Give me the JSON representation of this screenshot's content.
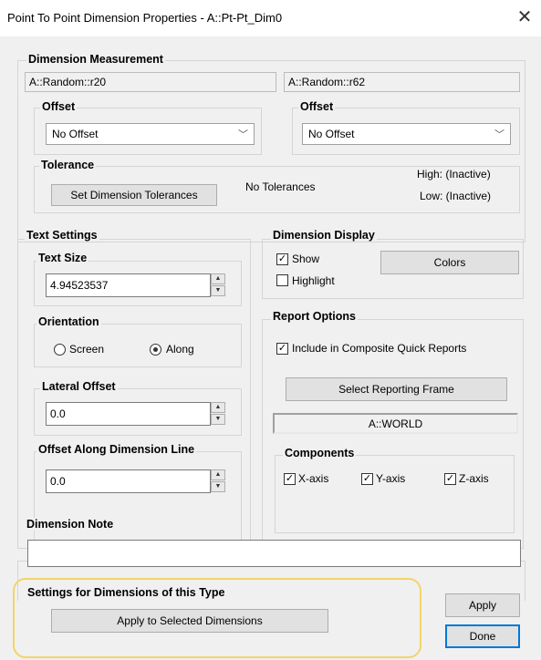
{
  "window": {
    "title": "Point To Point Dimension Properties - A::Pt-Pt_Dim0",
    "close_glyph": "✕"
  },
  "measurement": {
    "title": "Dimension Measurement",
    "point1": "A::Random::r20",
    "point2": "A::Random::r62",
    "offset1_label": "Offset",
    "offset1_value": "No Offset",
    "offset2_label": "Offset",
    "offset2_value": "No Offset"
  },
  "tolerance": {
    "title": "Tolerance",
    "set_button": "Set Dimension Tolerances",
    "status": "No Tolerances",
    "high": "High: (Inactive)",
    "low": "Low: (Inactive)"
  },
  "text_settings": {
    "title": "Text Settings",
    "size_label": "Text Size",
    "size_value": "4.94523537",
    "orientation_label": "Orientation",
    "screen": "Screen",
    "along": "Along",
    "selected": "Along",
    "lateral_label": "Lateral Offset",
    "lateral_value": "0.0",
    "along_offset_label": "Offset Along Dimension Line",
    "along_offset_value": "0.0"
  },
  "display": {
    "title": "Dimension Display",
    "show": "Show",
    "show_checked": true,
    "highlight": "Highlight",
    "highlight_checked": false,
    "colors_button": "Colors"
  },
  "report": {
    "title": "Report Options",
    "include": "Include in Composite Quick Reports",
    "include_checked": true,
    "select_frame_button": "Select Reporting Frame",
    "frame_value": "A::WORLD"
  },
  "components": {
    "title": "Components",
    "x": "X-axis",
    "y": "Y-axis",
    "z": "Z-axis"
  },
  "note": {
    "title": "Dimension Note",
    "value": ""
  },
  "type_settings": {
    "title": "Settings for Dimensions of this Type",
    "apply_selected_button": "Apply to Selected Dimensions"
  },
  "buttons": {
    "apply": "Apply",
    "done": "Done"
  },
  "icons": {
    "check": "✓",
    "dropdown": "chevron-down-icon",
    "spin": "spin-arrows-icon"
  },
  "colors": {
    "highlight_ring": "#f2d46b",
    "dialog_bg": "#f0f0f0"
  }
}
